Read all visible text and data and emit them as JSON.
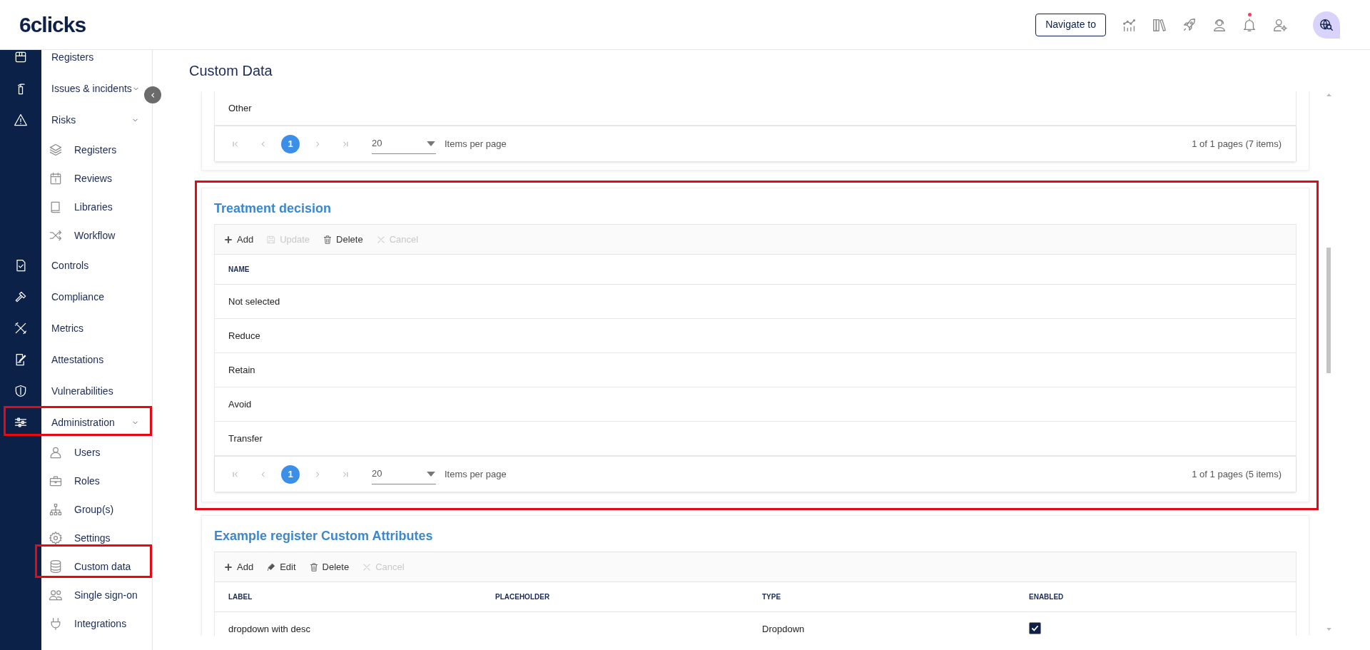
{
  "header": {
    "logo": "6clicks",
    "navigate_button": "Navigate to",
    "notifications_unread": true
  },
  "sidebar": [
    {
      "kind": "section",
      "label": "Registers",
      "expandable": false,
      "highlighted": false
    },
    {
      "kind": "section",
      "label": "Issues & incidents",
      "expandable": true,
      "highlighted": false
    },
    {
      "kind": "section",
      "label": "Risks",
      "expandable": true,
      "highlighted": false
    },
    {
      "kind": "subitem",
      "label": "Registers",
      "highlighted": false
    },
    {
      "kind": "subitem",
      "label": "Reviews",
      "highlighted": false
    },
    {
      "kind": "subitem",
      "label": "Libraries",
      "highlighted": false
    },
    {
      "kind": "subitem",
      "label": "Workflow",
      "highlighted": false
    },
    {
      "kind": "section",
      "label": "Controls",
      "expandable": false,
      "highlighted": false
    },
    {
      "kind": "section",
      "label": "Compliance",
      "expandable": false,
      "highlighted": false
    },
    {
      "kind": "section",
      "label": "Metrics",
      "expandable": false,
      "highlighted": false
    },
    {
      "kind": "section",
      "label": "Attestations",
      "expandable": false,
      "highlighted": false
    },
    {
      "kind": "section",
      "label": "Vulnerabilities",
      "expandable": false,
      "highlighted": false
    },
    {
      "kind": "section",
      "label": "Administration",
      "expandable": true,
      "highlighted": true
    },
    {
      "kind": "subitem",
      "label": "Users",
      "highlighted": false
    },
    {
      "kind": "subitem",
      "label": "Roles",
      "highlighted": false
    },
    {
      "kind": "subitem",
      "label": "Group(s)",
      "highlighted": false
    },
    {
      "kind": "subitem",
      "label": "Settings",
      "highlighted": false
    },
    {
      "kind": "subitem",
      "label": "Custom data",
      "highlighted": true
    },
    {
      "kind": "subitem",
      "label": "Single sign-on",
      "highlighted": false
    },
    {
      "kind": "subitem",
      "label": "Integrations",
      "highlighted": false
    }
  ],
  "page_title": "Custom Data",
  "sections": [
    {
      "highlighted": false,
      "rows": [
        {
          "cells": [
            "Other"
          ]
        }
      ],
      "pager": {
        "pages": [
          {
            "label": "1",
            "selected": true
          }
        ],
        "page_size": "20",
        "page_size_label": "Items per page",
        "summary": "1 of 1 pages (7 items)"
      }
    },
    {
      "title": "Treatment decision",
      "highlighted": true,
      "toolbar": [
        {
          "kind": "add",
          "label": "Add",
          "disabled": false
        },
        {
          "kind": "save",
          "label": "Update",
          "disabled": true
        },
        {
          "kind": "delete",
          "label": "Delete",
          "disabled": false
        },
        {
          "kind": "cancel",
          "label": "Cancel",
          "disabled": true
        }
      ],
      "columns": [
        "NAME"
      ],
      "rows": [
        {
          "cells": [
            "Not selected"
          ]
        },
        {
          "cells": [
            "Reduce"
          ]
        },
        {
          "cells": [
            "Retain"
          ]
        },
        {
          "cells": [
            "Avoid"
          ]
        },
        {
          "cells": [
            "Transfer"
          ]
        }
      ],
      "pager": {
        "pages": [
          {
            "label": "1",
            "selected": true
          }
        ],
        "page_size": "20",
        "page_size_label": "Items per page",
        "summary": "1 of 1 pages (5 items)"
      }
    },
    {
      "title": "Example register Custom Attributes",
      "highlighted": false,
      "toolbar": [
        {
          "kind": "add",
          "label": "Add",
          "disabled": false
        },
        {
          "kind": "edit",
          "label": "Edit",
          "disabled": false
        },
        {
          "kind": "delete",
          "label": "Delete",
          "disabled": false
        },
        {
          "kind": "cancel",
          "label": "Cancel",
          "disabled": true
        }
      ],
      "columns": [
        "LABEL",
        "PLACEHOLDER",
        "TYPE",
        "ENABLED"
      ],
      "rows": [
        {
          "cells": [
            "dropdown with desc",
            null,
            "Dropdown",
            {
              "kind": "checkbox",
              "checked": true
            }
          ]
        }
      ]
    }
  ]
}
